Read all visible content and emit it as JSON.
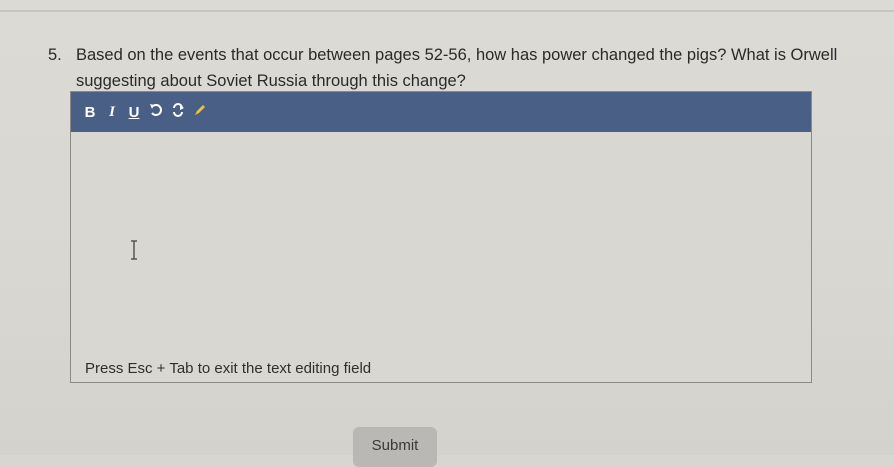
{
  "question": {
    "number": "5.",
    "text": "Based on the events that occur between pages 52-56, how has power changed the pigs? What is Orwell suggesting about Soviet Russia through this change?"
  },
  "editor": {
    "toolbar": {
      "bold": "B",
      "italic": "I",
      "underline": "U",
      "undo_icon": "undo-icon",
      "redo_icon": "redo-icon",
      "pen_icon": "pen-icon",
      "background_color": "#4a5f86"
    },
    "content": "",
    "hint": "Press Esc + Tab to exit the text editing field"
  },
  "submit": {
    "label": "Submit"
  }
}
